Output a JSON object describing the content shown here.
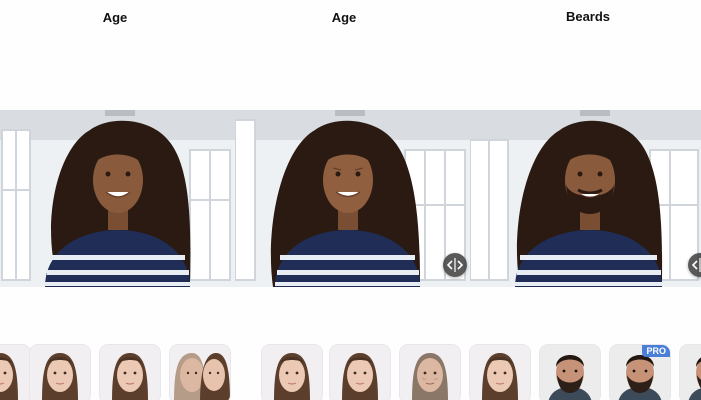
{
  "columns": [
    {
      "title": "Age"
    },
    {
      "title": "Age"
    },
    {
      "title": "Beards"
    }
  ],
  "icons": {
    "compare_handle": "compare-slider-handle-icon"
  },
  "thumbnails": [
    {
      "kind": "female-young",
      "pro": false
    },
    {
      "kind": "female-young",
      "pro": false
    },
    {
      "kind": "female-young",
      "pro": false
    },
    {
      "kind": "female-old-split",
      "pro": false
    },
    {
      "kind": "female-young",
      "pro": false
    },
    {
      "kind": "female-young",
      "pro": false
    },
    {
      "kind": "female-old",
      "pro": false
    },
    {
      "kind": "female-young",
      "pro": false
    },
    {
      "kind": "male-beard",
      "pro": false
    },
    {
      "kind": "male-beard",
      "pro": true
    },
    {
      "kind": "male-beard",
      "pro": false
    }
  ],
  "pro_label": "PRO",
  "colors": {
    "sweater": "#1f2d57",
    "stripe": "#e8ecf3",
    "hair": "#2a1a12",
    "skin": "#8a5a3c",
    "background_window": "#eef1f3",
    "pro_badge": "#4a7fd8"
  }
}
